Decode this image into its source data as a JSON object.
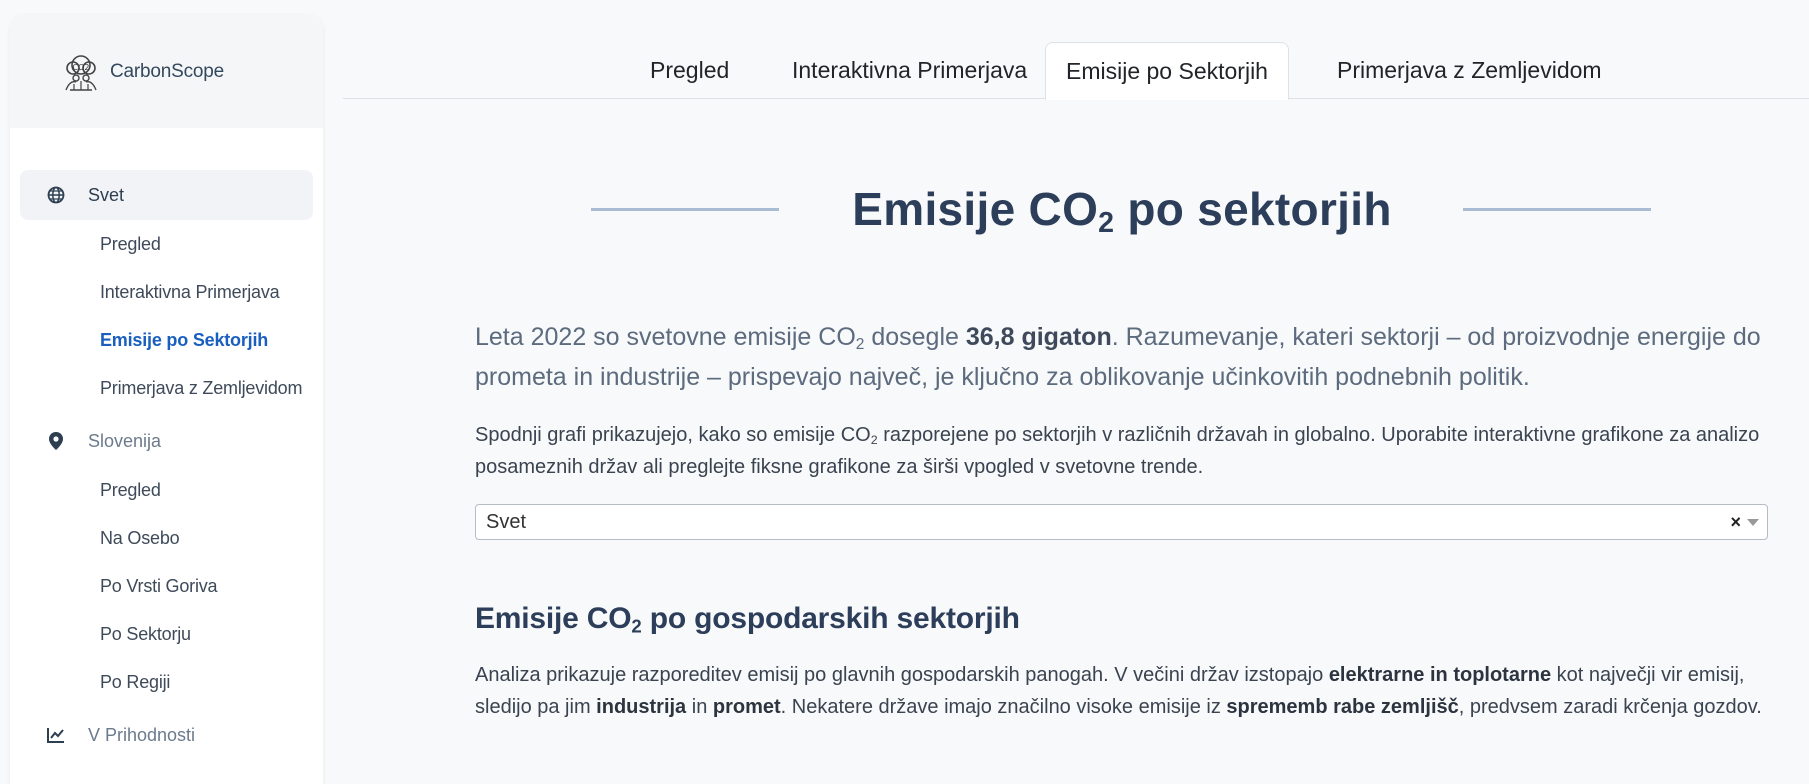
{
  "app": {
    "name": "CarbonScope"
  },
  "sidebar": {
    "groups": [
      {
        "label": "Svet",
        "icon": "globe-icon",
        "active": true,
        "items": [
          "Pregled",
          "Interaktivna Primerjava",
          "Emisije po Sektorjih",
          "Primerjava z Zemljevidom"
        ],
        "current_item": "Emisije po Sektorjih"
      },
      {
        "label": "Slovenija",
        "icon": "map-pin-icon",
        "items": [
          "Pregled",
          "Na Osebo",
          "Po Vrsti Goriva",
          "Po Sektorju",
          "Po Regiji"
        ]
      },
      {
        "label": "V Prihodnosti",
        "icon": "chart-line-icon",
        "items": []
      }
    ]
  },
  "tabs": [
    {
      "label": "Pregled",
      "active": false
    },
    {
      "label": "Interaktivna Primerjava",
      "active": false
    },
    {
      "label": "Emisije po Sektorjih",
      "active": true
    },
    {
      "label": "Primerjava z Zemljevidom",
      "active": false
    }
  ],
  "main": {
    "title_pre": "Emisije CO",
    "title_sub": "2",
    "title_post": " po sektorjih",
    "lead": {
      "p1": "Leta 2022 so svetovne emisije CO",
      "sub": "2",
      "p2": " dosegle ",
      "bold": "36,8 gigaton",
      "p3": ". Razumevanje, kateri sektorji – od proizvodnje energije do prometa in industrije – prispevajo največ, je ključno za oblikovanje učinkovitih podnebnih politik."
    },
    "desc": {
      "p1": "Spodnji grafi prikazujejo, kako so emisije CO",
      "sub": "2",
      "p2": " razporejene po sektorjih v različnih državah in globalno. Uporabite interaktivne grafikone za analizo posameznih držav ali preglejte fiksne grafikone za širši vpogled v svetovne trende."
    },
    "select": {
      "value": "Svet",
      "clear": "×"
    },
    "section": {
      "title_pre": "Emisije CO",
      "title_sub": "2",
      "title_post": " po gospodarskih sektorjih",
      "t1": "Analiza prikazuje razporeditev emisij po glavnih gospodarskih panogah. V večini držav izstopajo ",
      "b1": "elektrarne in toplotarne",
      "t2": " kot največji vir emisij, sledijo pa jim ",
      "b2": "industrija",
      "t3": " in ",
      "b3": "promet",
      "t4": ". Nekatere države imajo značilno visoke emisije iz ",
      "b4": "sprememb rabe zemljišč",
      "t5": ", predvsem zaradi krčenja gozdov."
    }
  }
}
